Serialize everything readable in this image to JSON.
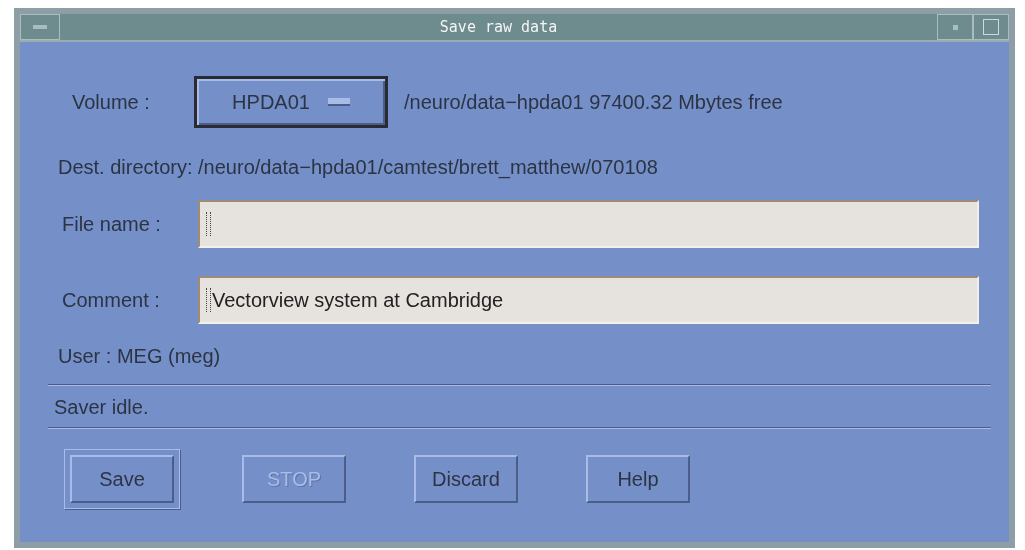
{
  "window": {
    "title": "Save raw data"
  },
  "volume": {
    "label": "Volume :",
    "option": "HPDA01",
    "info": "/neuro/data−hpda01 97400.32 Mbytes free"
  },
  "dest_directory": "Dest. directory: /neuro/data−hpda01/camtest/brett_matthew/070108",
  "fields": [
    {
      "label": "File name :"
    },
    {
      "label": "Comment :",
      "value": "Vectorview system at Cambridge"
    }
  ],
  "user": "User : MEG (meg)",
  "status": "Saver idle.",
  "buttons": [
    {
      "label": "Save",
      "default": true,
      "disabled": false
    },
    {
      "label": "STOP",
      "default": false,
      "disabled": true
    },
    {
      "label": "Discard",
      "default": false,
      "disabled": false
    },
    {
      "label": "Help",
      "default": false,
      "disabled": false
    }
  ]
}
